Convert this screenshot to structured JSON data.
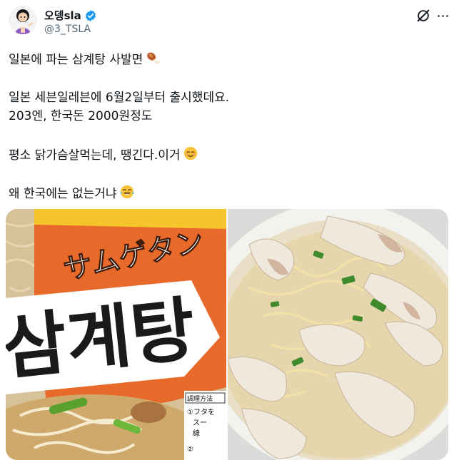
{
  "author": {
    "display_name": "오뎅sla",
    "handle": "@3_TSLA",
    "verified": true
  },
  "tweet": {
    "line1": "일본에 파는 삼계탕 사발면",
    "line2": "일본 세븐일레븐에 6월2일부터 출시했데요.",
    "line3": "203엔, 한국돈 2000원정도",
    "line4": "평소 닭가슴살먹는데, 땡긴다.이거",
    "line5": "왜 한국에는 없는거냐"
  },
  "media": {
    "left": {
      "katakana": "サムゲタン",
      "hangul": "삼계탕",
      "label_top": "調理方法",
      "label_line1": "①フタを",
      "label_line2": "スー",
      "label_line3": "線",
      "label_line4": "②"
    }
  },
  "colors": {
    "accent": "#1d9bf0",
    "text": "#0f1419",
    "muted": "#536471",
    "package_orange": "#e86a2a",
    "package_yellow": "#f6c42b"
  },
  "icons": {
    "verified": "verified-badge-icon",
    "grok": "grok-icon",
    "more": "more-icon",
    "drumstick": "drumstick-emoji",
    "smile": "relieved-face-emoji",
    "laugh": "tears-of-joy-emoji"
  }
}
